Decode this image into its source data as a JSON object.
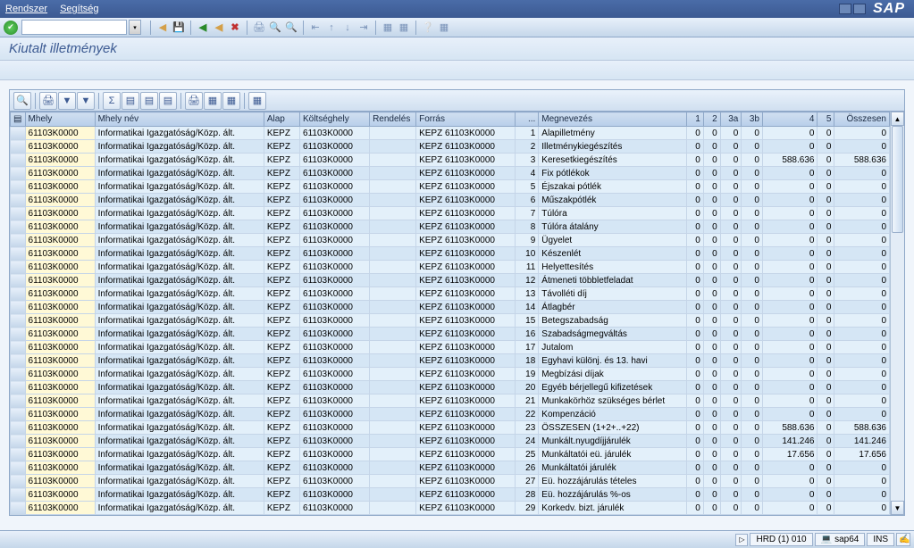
{
  "menu": {
    "system": "Rendszer",
    "help": "Segítség"
  },
  "logo": "SAP",
  "title": "Kiutalt illetmények",
  "columns": {
    "mhely": "Mhely",
    "mhely_nev": "Mhely név",
    "alap": "Alap",
    "koltseghely": "Költséghely",
    "rendeles": "Rendelés",
    "forras": "Forrás",
    "dots": "...",
    "megnevezes": "Megnevezés",
    "c1": "1",
    "c2": "2",
    "c3a": "3a",
    "c3b": "3b",
    "c4": "4",
    "c5": "5",
    "osszesen": "Összesen"
  },
  "common": {
    "mhely": "61103K0000",
    "mhely_nev": "Informatikai Igazgatóság/Közp. ált.",
    "alap": "KEPZ",
    "koltseghely": "61103K0000",
    "rendeles": "",
    "forras": "KEPZ 61103K0000"
  },
  "rows": [
    {
      "n": 1,
      "meg": "Alapilletmény",
      "c1": 0,
      "c2": 0,
      "c3a": 0,
      "c3b": 0,
      "c4": 0,
      "c5": 0,
      "sum": 0
    },
    {
      "n": 2,
      "meg": "Illetménykiegészítés",
      "c1": 0,
      "c2": 0,
      "c3a": 0,
      "c3b": 0,
      "c4": 0,
      "c5": 0,
      "sum": 0
    },
    {
      "n": 3,
      "meg": "Keresetkiegészítés",
      "c1": 0,
      "c2": 0,
      "c3a": 0,
      "c3b": 0,
      "c4": "588.636",
      "c5": 0,
      "sum": "588.636"
    },
    {
      "n": 4,
      "meg": "Fix pótlékok",
      "c1": 0,
      "c2": 0,
      "c3a": 0,
      "c3b": 0,
      "c4": 0,
      "c5": 0,
      "sum": 0
    },
    {
      "n": 5,
      "meg": "Éjszakai pótlék",
      "c1": 0,
      "c2": 0,
      "c3a": 0,
      "c3b": 0,
      "c4": 0,
      "c5": 0,
      "sum": 0
    },
    {
      "n": 6,
      "meg": "Műszakpótlék",
      "c1": 0,
      "c2": 0,
      "c3a": 0,
      "c3b": 0,
      "c4": 0,
      "c5": 0,
      "sum": 0
    },
    {
      "n": 7,
      "meg": "Túlóra",
      "c1": 0,
      "c2": 0,
      "c3a": 0,
      "c3b": 0,
      "c4": 0,
      "c5": 0,
      "sum": 0
    },
    {
      "n": 8,
      "meg": "Túlóra átalány",
      "c1": 0,
      "c2": 0,
      "c3a": 0,
      "c3b": 0,
      "c4": 0,
      "c5": 0,
      "sum": 0
    },
    {
      "n": 9,
      "meg": "Ügyelet",
      "c1": 0,
      "c2": 0,
      "c3a": 0,
      "c3b": 0,
      "c4": 0,
      "c5": 0,
      "sum": 0
    },
    {
      "n": 10,
      "meg": "Készenlét",
      "c1": 0,
      "c2": 0,
      "c3a": 0,
      "c3b": 0,
      "c4": 0,
      "c5": 0,
      "sum": 0
    },
    {
      "n": 11,
      "meg": "Helyettesítés",
      "c1": 0,
      "c2": 0,
      "c3a": 0,
      "c3b": 0,
      "c4": 0,
      "c5": 0,
      "sum": 0
    },
    {
      "n": 12,
      "meg": "Átmeneti többletfeladat",
      "c1": 0,
      "c2": 0,
      "c3a": 0,
      "c3b": 0,
      "c4": 0,
      "c5": 0,
      "sum": 0
    },
    {
      "n": 13,
      "meg": "Távolléti díj",
      "c1": 0,
      "c2": 0,
      "c3a": 0,
      "c3b": 0,
      "c4": 0,
      "c5": 0,
      "sum": 0
    },
    {
      "n": 14,
      "meg": "Átlagbér",
      "c1": 0,
      "c2": 0,
      "c3a": 0,
      "c3b": 0,
      "c4": 0,
      "c5": 0,
      "sum": 0
    },
    {
      "n": 15,
      "meg": "Betegszabadság",
      "c1": 0,
      "c2": 0,
      "c3a": 0,
      "c3b": 0,
      "c4": 0,
      "c5": 0,
      "sum": 0
    },
    {
      "n": 16,
      "meg": "Szabadságmegváltás",
      "c1": 0,
      "c2": 0,
      "c3a": 0,
      "c3b": 0,
      "c4": 0,
      "c5": 0,
      "sum": 0
    },
    {
      "n": 17,
      "meg": "Jutalom",
      "c1": 0,
      "c2": 0,
      "c3a": 0,
      "c3b": 0,
      "c4": 0,
      "c5": 0,
      "sum": 0
    },
    {
      "n": 18,
      "meg": "Egyhavi különj. és 13. havi",
      "c1": 0,
      "c2": 0,
      "c3a": 0,
      "c3b": 0,
      "c4": 0,
      "c5": 0,
      "sum": 0
    },
    {
      "n": 19,
      "meg": "Megbízási díjak",
      "c1": 0,
      "c2": 0,
      "c3a": 0,
      "c3b": 0,
      "c4": 0,
      "c5": 0,
      "sum": 0
    },
    {
      "n": 20,
      "meg": "Egyéb bérjellegű kifizetések",
      "c1": 0,
      "c2": 0,
      "c3a": 0,
      "c3b": 0,
      "c4": 0,
      "c5": 0,
      "sum": 0
    },
    {
      "n": 21,
      "meg": "Munkakörhöz szükséges bérlet",
      "c1": 0,
      "c2": 0,
      "c3a": 0,
      "c3b": 0,
      "c4": 0,
      "c5": 0,
      "sum": 0
    },
    {
      "n": 22,
      "meg": "Kompenzáció",
      "c1": 0,
      "c2": 0,
      "c3a": 0,
      "c3b": 0,
      "c4": 0,
      "c5": 0,
      "sum": 0
    },
    {
      "n": 23,
      "meg": "ÖSSZESEN (1+2+..+22)",
      "c1": 0,
      "c2": 0,
      "c3a": 0,
      "c3b": 0,
      "c4": "588.636",
      "c5": 0,
      "sum": "588.636"
    },
    {
      "n": 24,
      "meg": "Munkált.nyugdíjjárulék",
      "c1": 0,
      "c2": 0,
      "c3a": 0,
      "c3b": 0,
      "c4": "141.246",
      "c5": 0,
      "sum": "141.246"
    },
    {
      "n": 25,
      "meg": "Munkáltatói eü. járulék",
      "c1": 0,
      "c2": 0,
      "c3a": 0,
      "c3b": 0,
      "c4": "17.656",
      "c5": 0,
      "sum": "17.656"
    },
    {
      "n": 26,
      "meg": "Munkáltatói járulék",
      "c1": 0,
      "c2": 0,
      "c3a": 0,
      "c3b": 0,
      "c4": 0,
      "c5": 0,
      "sum": 0
    },
    {
      "n": 27,
      "meg": "Eü. hozzájárulás tételes",
      "c1": 0,
      "c2": 0,
      "c3a": 0,
      "c3b": 0,
      "c4": 0,
      "c5": 0,
      "sum": 0
    },
    {
      "n": 28,
      "meg": "Eü. hozzájárulás %-os",
      "c1": 0,
      "c2": 0,
      "c3a": 0,
      "c3b": 0,
      "c4": 0,
      "c5": 0,
      "sum": 0
    },
    {
      "n": 29,
      "meg": "Korkedv. bizt. járulék",
      "c1": 0,
      "c2": 0,
      "c3a": 0,
      "c3b": 0,
      "c4": 0,
      "c5": 0,
      "sum": 0
    }
  ],
  "status": {
    "session": "HRD (1) 010",
    "server": "sap64",
    "mode": "INS"
  }
}
